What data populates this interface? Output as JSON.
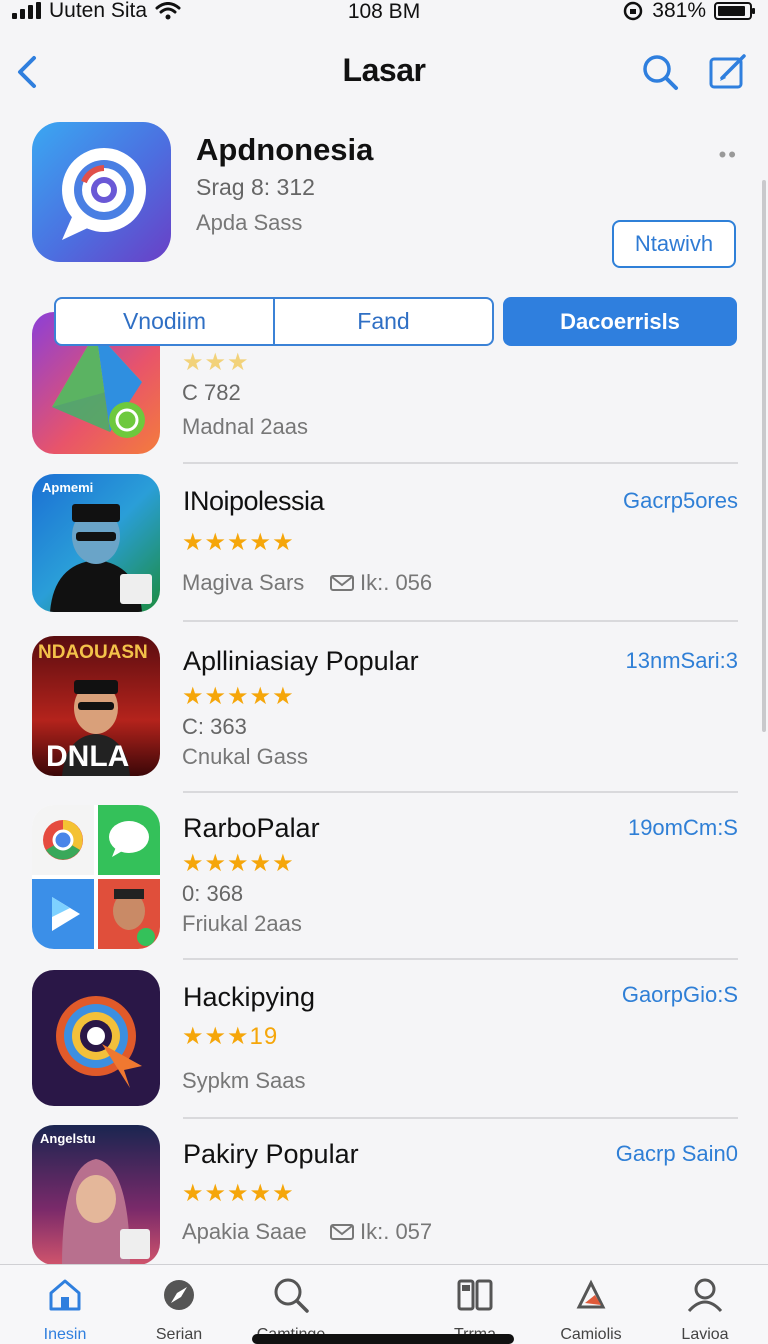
{
  "status": {
    "carrier": "Uuten Sita",
    "time": "108 BM",
    "battery": "381%"
  },
  "nav": {
    "title": "Lasar"
  },
  "header_app": {
    "name": "Apdnonesia",
    "subtitle": "Srag 8: 312",
    "category": "Apda Sass",
    "more": "••",
    "get_label": "Ntawivh"
  },
  "segments": [
    "Vnodiim",
    "Fand",
    "Dacoerrisls"
  ],
  "apps": [
    {
      "name": "",
      "stars": "★★★",
      "line1": "C 782",
      "line2": "Madnal 2aas",
      "meta": "",
      "action": ""
    },
    {
      "name": "INoipolessia",
      "stars": "★★★★★",
      "line1": "",
      "line2": "Magiva Sars",
      "meta": "Ik:. 056",
      "action": "Gacrp5ores",
      "icon_label": "Apmemi"
    },
    {
      "name": "Aplliniasiay Popular",
      "stars": "★★★★★",
      "line1": "C: 363",
      "line2": "Cnukal Gass",
      "meta": "",
      "action": "13nmSari:3",
      "icon_label": "NDAOUASN",
      "icon_label2": "DNLA"
    },
    {
      "name": "RarboPalar",
      "stars": "★★★★★",
      "line1": "0: 368",
      "line2": "Friukal 2aas",
      "meta": "",
      "action": "19omCm:S"
    },
    {
      "name": "Hackipying",
      "stars": "★★★19",
      "line1": "",
      "line2": "Sypkm Saas",
      "meta": "",
      "action": "GaorpGio:S"
    },
    {
      "name": "Pakiry Popular",
      "stars": "★★★★★",
      "line1": "",
      "line2": "Apakia Saae",
      "meta": "Ik:. 057",
      "action": "Gacrp Sain0",
      "icon_label": "Angelstu"
    }
  ],
  "tabs": [
    "Inesin",
    "Serian",
    "Camtinge",
    "Trrma",
    "Camiolis",
    "Lavioa"
  ],
  "colors": {
    "accent": "#2f7fde",
    "star": "#f5a60a"
  }
}
